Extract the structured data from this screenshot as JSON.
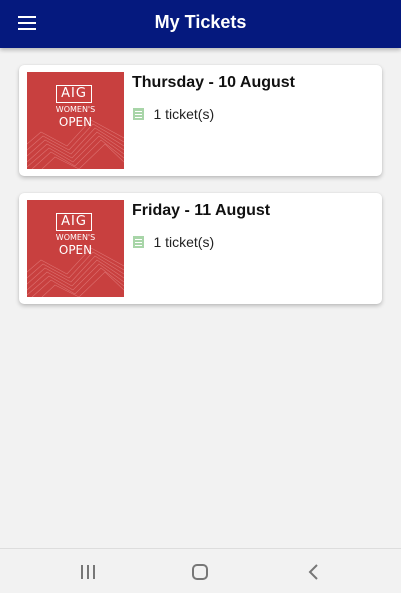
{
  "header": {
    "title": "My Tickets"
  },
  "tickets": [
    {
      "date": "Thursday - 10 August",
      "count_text": "1 ticket(s)",
      "logo": {
        "brand": "AIG",
        "line1": "WOMEN'S",
        "line2": "OPEN"
      }
    },
    {
      "date": "Friday - 11 August",
      "count_text": "1 ticket(s)",
      "logo": {
        "brand": "AIG",
        "line1": "WOMEN'S",
        "line2": "OPEN"
      }
    }
  ],
  "icons": {
    "menu": "hamburger-menu-icon",
    "ticket": "list-icon",
    "nav_recent": "recent-apps-icon",
    "nav_home": "home-icon",
    "nav_back": "back-icon"
  },
  "colors": {
    "app_bar": "#05197e",
    "thumbnail": "#c8403f",
    "ticket_icon": "#a8d5a8",
    "background": "#f2f2f2"
  }
}
